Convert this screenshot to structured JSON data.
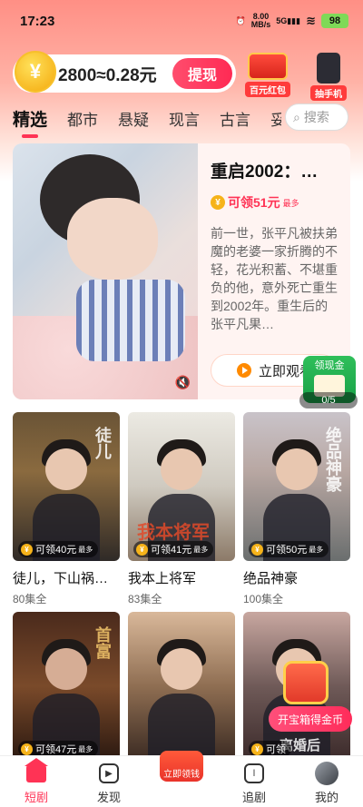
{
  "status": {
    "time": "17:23",
    "net_speed": "8.00",
    "net_unit": "MB/s",
    "net_type": "5G",
    "battery": "98"
  },
  "coins": {
    "symbol": "¥",
    "balance_text": "2800≈0.28元",
    "withdraw_label": "提现"
  },
  "promos": [
    {
      "label": "百元红包"
    },
    {
      "label": "抽手机"
    }
  ],
  "tabs": [
    "精选",
    "都市",
    "悬疑",
    "现言",
    "古言",
    "妥"
  ],
  "search": {
    "placeholder": "搜索"
  },
  "feature": {
    "title": "重启2002：…",
    "reward": "可领51元",
    "reward_more": "最多",
    "description": "前一世，张平凡被扶弟魔的老婆一家折腾的不轻，花光积蓄、不堪重负的他，意外死亡重生到2002年。重生后的张平凡果…",
    "watch_label": "立即观看"
  },
  "cash_float": {
    "label": "领现金",
    "progress": "0/5"
  },
  "dramas": [
    {
      "title": "徒儿，下山祸…",
      "episodes": "80集全",
      "reward": "可领40元",
      "more": "最多",
      "art": "徒儿"
    },
    {
      "title": "我本上将军",
      "episodes": "83集全",
      "reward": "可领41元",
      "more": "最多",
      "art": "我本将军"
    },
    {
      "title": "绝品神豪",
      "episodes": "100集全",
      "reward": "可领50元",
      "more": "最多",
      "art": "绝品神豪"
    },
    {
      "title": "",
      "episodes": "",
      "reward": "可领47元",
      "more": "最多",
      "art": "首富"
    },
    {
      "title": "",
      "episodes": "",
      "reward": "立即领钱",
      "more": "",
      "art": ""
    },
    {
      "title": "",
      "episodes": "",
      "reward": "可领",
      "more": "",
      "art": "离婚后"
    }
  ],
  "treasure": {
    "label": "开宝箱得金币"
  },
  "nav": [
    {
      "label": "短剧",
      "icon": "home-icon"
    },
    {
      "label": "发现",
      "icon": "play-icon"
    },
    {
      "label": "立即领钱",
      "icon": "money-envelope-icon"
    },
    {
      "label": "追剧",
      "icon": "bookmark-icon"
    },
    {
      "label": "我的",
      "icon": "avatar-icon"
    }
  ],
  "colors": {
    "accent": "#ff3355",
    "reward": "#ff3355",
    "coin": "#f6b319"
  }
}
